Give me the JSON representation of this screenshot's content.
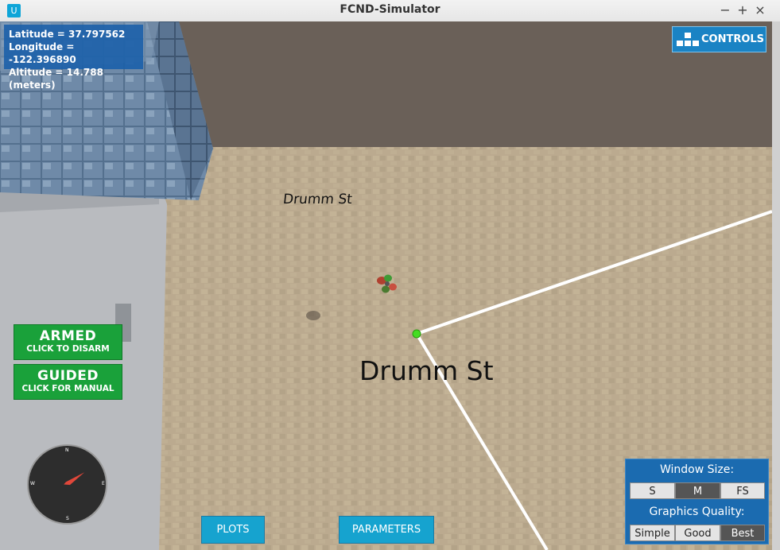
{
  "window": {
    "title": "FCND-Simulator",
    "minimize": "−",
    "maximize": "+",
    "close": "×",
    "app_icon": "unity-icon"
  },
  "hud": {
    "latitude": "Latitude = 37.797562",
    "longitude": "Longitude = -122.396890",
    "altitude": "Altitude = 14.788 (meters)"
  },
  "controls_button": {
    "label": "CONTROLS",
    "icon": "keyboard-icon"
  },
  "armed_button": {
    "state": "ARMED",
    "action": "CLICK TO DISARM"
  },
  "guided_button": {
    "state": "GUIDED",
    "action": "CLICK FOR MANUAL"
  },
  "compass": {
    "n": "N",
    "e": "E",
    "s": "S",
    "w": "W",
    "heading_deg": 55
  },
  "bottom": {
    "plots": "PLOTS",
    "parameters": "PARAMETERS"
  },
  "settings": {
    "window_size_label": "Window Size:",
    "window_sizes": [
      "S",
      "M",
      "FS"
    ],
    "window_size_selected": "M",
    "quality_label": "Graphics Quality:",
    "qualities": [
      "Simple",
      "Good",
      "Best"
    ],
    "quality_selected": "Best"
  },
  "scene": {
    "street_label_far": "Drumm St",
    "street_label_near": "Drumm St",
    "colors": {
      "sky": "#6a6058",
      "ground": "#b9a88d",
      "path": "#ffffff",
      "waypoint": "#44dd22"
    }
  }
}
